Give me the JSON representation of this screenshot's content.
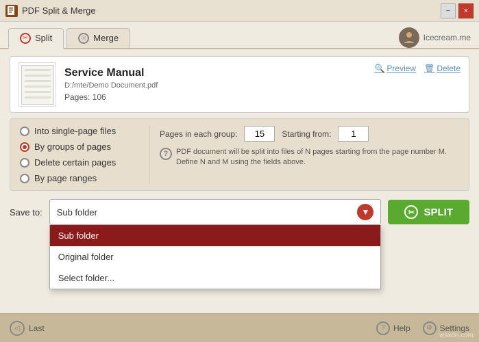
{
  "titlebar": {
    "icon_label": "PS",
    "title": "PDF Split & Merge",
    "minimize": "−",
    "close": "×"
  },
  "tabs": [
    {
      "id": "split",
      "label": "Split",
      "active": true
    },
    {
      "id": "merge",
      "label": "Merge",
      "active": false
    }
  ],
  "badge": {
    "label": "Icecream.me"
  },
  "file": {
    "title": "Service Manual",
    "path": "D:/mte/Demo Document.pdf",
    "pages_label": "Pages:",
    "pages_count": "106",
    "preview_link": "Preview",
    "delete_link": "Delete"
  },
  "options": {
    "radio_items": [
      {
        "id": "single",
        "label": "Into single-page files",
        "selected": false
      },
      {
        "id": "groups",
        "label": "By groups of pages",
        "selected": true
      },
      {
        "id": "delete",
        "label": "Delete certain pages",
        "selected": false
      },
      {
        "id": "ranges",
        "label": "By page ranges",
        "selected": false
      }
    ],
    "pages_in_group_label": "Pages in each group:",
    "pages_in_group_value": "15",
    "starting_from_label": "Starting from:",
    "starting_from_value": "1",
    "description": "PDF document will be split into files of N pages starting from the page number M. Define N and M using the fields above.",
    "info_icon": "?"
  },
  "saveto": {
    "label": "Save to:",
    "current_value": "Sub folder",
    "dropdown_items": [
      {
        "label": "Sub folder",
        "selected": true
      },
      {
        "label": "Original folder",
        "selected": false
      },
      {
        "label": "Select folder...",
        "selected": false
      }
    ]
  },
  "split_button": {
    "label": "SPLIT"
  },
  "bottombar": {
    "last_label": "Last",
    "help_label": "Help",
    "settings_label": "Settings"
  },
  "watermark": "wsxdn.com"
}
